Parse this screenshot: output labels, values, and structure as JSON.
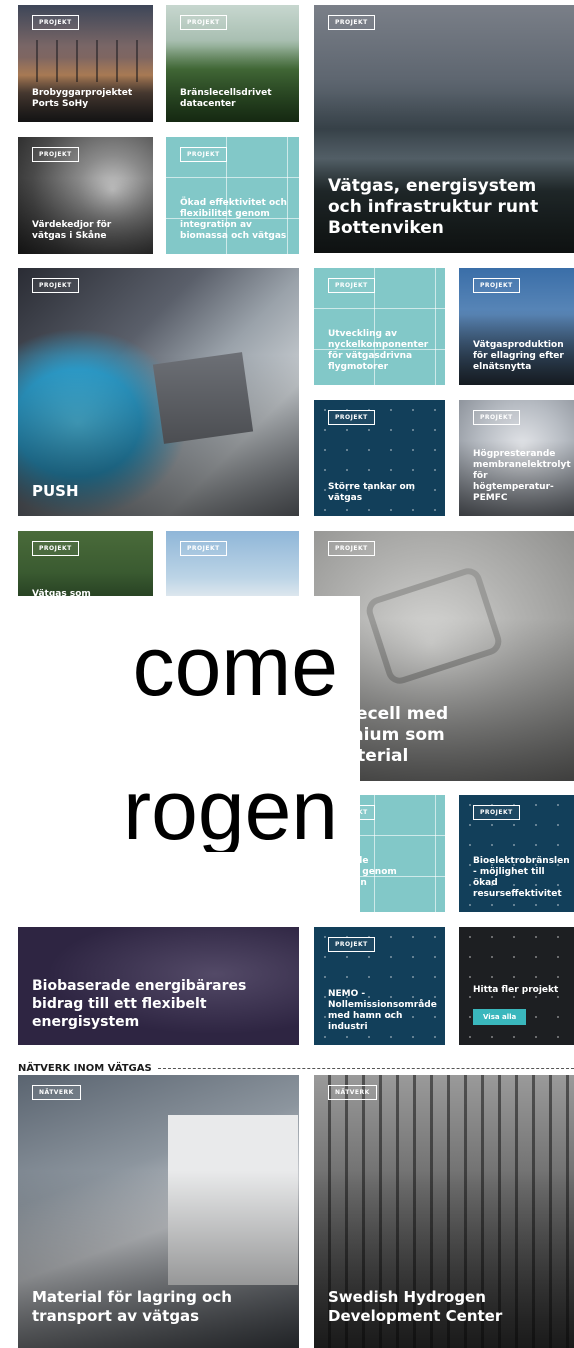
{
  "tiles": [
    {
      "badge": "PROJEKT",
      "title": "Brobyggarprojektet Ports SoHy"
    },
    {
      "badge": "PROJEKT",
      "title": "Bränslecellsdrivet datacenter"
    },
    {
      "badge": "PROJEKT",
      "title": "Vätgas, energisystem och infrastruktur runt Bottenviken"
    },
    {
      "badge": "PROJEKT",
      "title": "Värdekedjor för vätgas i Skåne"
    },
    {
      "badge": "PROJEKT",
      "title": "Ökad effektivitet och flexibilitet genom integration av biomassa och vätgas"
    },
    {
      "badge": "PROJEKT",
      "title": "PUSH"
    },
    {
      "badge": "PROJEKT",
      "title": "Utveckling av nyckelkomponenter för vätgasdrivna flygmotorer"
    },
    {
      "badge": "PROJEKT",
      "title": "Vätgasproduktion för ellagring efter elnätsnytta"
    },
    {
      "badge": "PROJEKT",
      "title": "Större tankar om vätgas"
    },
    {
      "badge": "PROJEKT",
      "title": "Högpresterande membranelektrolyt för högtemperatur-PEMFC"
    },
    {
      "badge": "PROJEKT",
      "title": "Vätgas som"
    },
    {
      "badge": "PROJEKT",
      "title": ""
    },
    {
      "badge": "PROJEKT",
      "title": "nslecell med\nminium som\nmaterial"
    },
    {
      "badge": "PROJEKT",
      "title": "säkrade\nmedel genom\nrta från\ntid"
    },
    {
      "badge": "PROJEKT",
      "title": "Bioelektrobränslen - möjlighet till ökad resurseffektivitet"
    },
    {
      "badge": "",
      "title": "Biobaserade energibärares bidrag till ett flexibelt energisystem"
    },
    {
      "badge": "PROJEKT",
      "title": "NEMO - Nollemissionsområde med hamn och industri"
    },
    {
      "badge": "",
      "title": "Hitta fler projekt",
      "button": "Visa alla"
    }
  ],
  "section": {
    "label": "NÄTVERK INOM VÄTGAS"
  },
  "network": [
    {
      "badge": "NÄTVERK",
      "title": "Material för lagring och transport av vätgas"
    },
    {
      "badge": "NÄTVERK",
      "title": "Swedish Hydrogen Development Center"
    }
  ],
  "overlay": {
    "line1": "come",
    "line2": "rogen"
  }
}
